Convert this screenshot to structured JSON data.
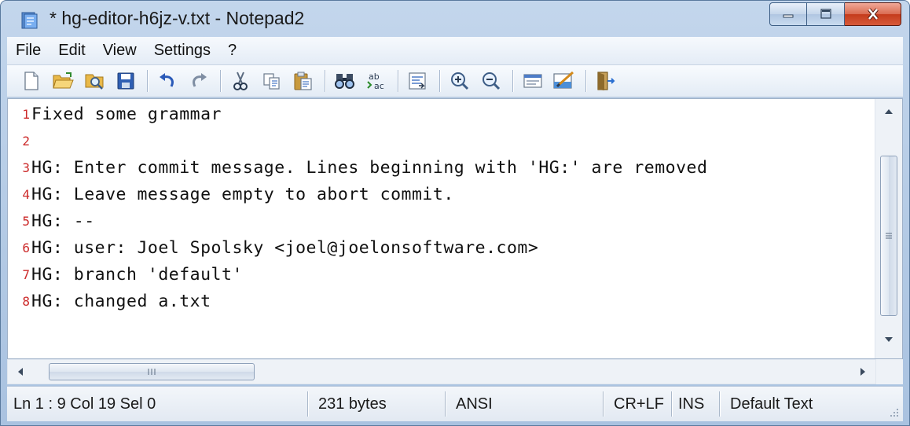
{
  "window": {
    "title": "* hg-editor-h6jz-v.txt - Notepad2",
    "app_icon": "notepad-icon"
  },
  "menu": {
    "items": [
      "File",
      "Edit",
      "View",
      "Settings",
      "?"
    ]
  },
  "toolbar": {
    "buttons": [
      "new-file-icon",
      "open-folder-icon",
      "browse-icon",
      "save-icon",
      "undo-icon",
      "redo-icon",
      "cut-icon",
      "copy-icon",
      "paste-icon",
      "find-icon",
      "replace-icon",
      "word-wrap-icon",
      "zoom-in-icon",
      "zoom-out-icon",
      "scheme-icon",
      "customize-scheme-icon",
      "exit-icon"
    ]
  },
  "editor": {
    "lines": [
      {
        "num": "1",
        "text": "Fixed some grammar"
      },
      {
        "num": "2",
        "text": ""
      },
      {
        "num": "3",
        "text": "HG: Enter commit message.  Lines beginning with 'HG:' are removed"
      },
      {
        "num": "4",
        "text": "HG: Leave message empty to abort commit."
      },
      {
        "num": "5",
        "text": "HG: --"
      },
      {
        "num": "6",
        "text": "HG: user: Joel Spolsky <joel@joelonsoftware.com>"
      },
      {
        "num": "7",
        "text": "HG: branch 'default'"
      },
      {
        "num": "8",
        "text": "HG: changed a.txt"
      }
    ]
  },
  "statusbar": {
    "position": "Ln 1 : 9   Col 19   Sel 0",
    "size": "231 bytes",
    "encoding": "ANSI",
    "line_endings": "CR+LF",
    "insert_mode": "INS",
    "scheme": "Default Text"
  },
  "colors": {
    "line_number": "#cc2a2a",
    "text": "#111111",
    "chrome": "#b2c9e4",
    "close_button": "#c43c1c"
  }
}
